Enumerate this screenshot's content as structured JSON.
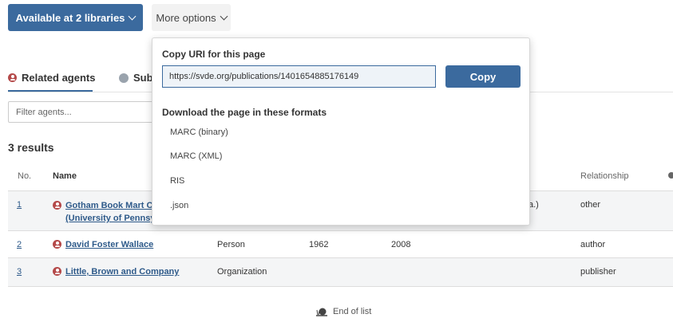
{
  "header": {
    "available_label": "Available at 2 libraries",
    "more_options_label": "More options"
  },
  "tabs": [
    {
      "label": "Related agents",
      "icon": "agent-icon"
    },
    {
      "label": "Subj",
      "icon": "subject-icon"
    }
  ],
  "filter": {
    "placeholder": "Filter agents..."
  },
  "results_label": "3 results",
  "table": {
    "headers": {
      "no": "No.",
      "name": "Name",
      "relationship": "Relationship"
    },
    "rows": [
      {
        "no": "1",
        "name_line1": "Gotham Book Mart Co",
        "name_line2": "(University of Pennsyl",
        "type": "",
        "born": "",
        "died": "",
        "extra": "a.)",
        "relationship": "other"
      },
      {
        "no": "2",
        "name_line1": "David Foster Wallace",
        "name_line2": "",
        "type": "Person",
        "born": "1962",
        "died": "2008",
        "extra": "",
        "relationship": "author"
      },
      {
        "no": "3",
        "name_line1": "Little, Brown and Company",
        "name_line2": "",
        "type": "Organization",
        "born": "",
        "died": "",
        "extra": "",
        "relationship": "publisher"
      }
    ]
  },
  "footer": {
    "label": "End of list",
    "icon": "snail-icon"
  },
  "dropdown": {
    "copy_uri_label": "Copy URI for this page",
    "uri_value": "https://svde.org/publications/1401654885176149",
    "copy_button": "Copy",
    "download_label": "Download the page in these formats",
    "formats": [
      "MARC (binary)",
      "MARC (XML)",
      "RIS",
      ".json"
    ]
  },
  "colors": {
    "primary": "#3b6a9e",
    "agent_icon": "#b44949",
    "link": "#2e5a8a"
  }
}
